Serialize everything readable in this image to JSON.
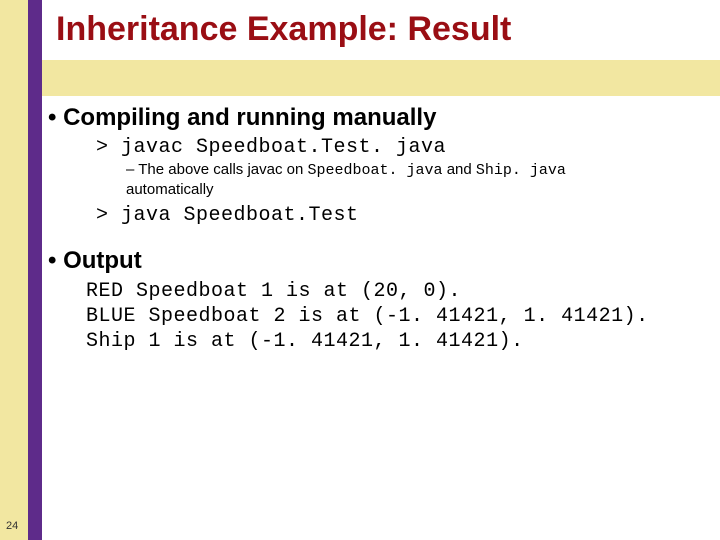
{
  "title": "Inheritance Example: Result",
  "section1": {
    "heading": "Compiling and running manually",
    "cmd1": "> javac Speedboat.Test. java",
    "note_prefix": "– The above calls javac on ",
    "note_code1": "Speedboat. java",
    "note_mid": " and ",
    "note_code2": "Ship. java",
    "note_suffix": "automatically",
    "cmd2": "> java Speedboat.Test"
  },
  "section2": {
    "heading": "Output",
    "lines": "RED Speedboat 1 is at (20, 0).\nBLUE Speedboat 2 is at (-1. 41421, 1. 41421).\nShip 1 is at (-1. 41421, 1. 41421)."
  },
  "page_number": "24"
}
